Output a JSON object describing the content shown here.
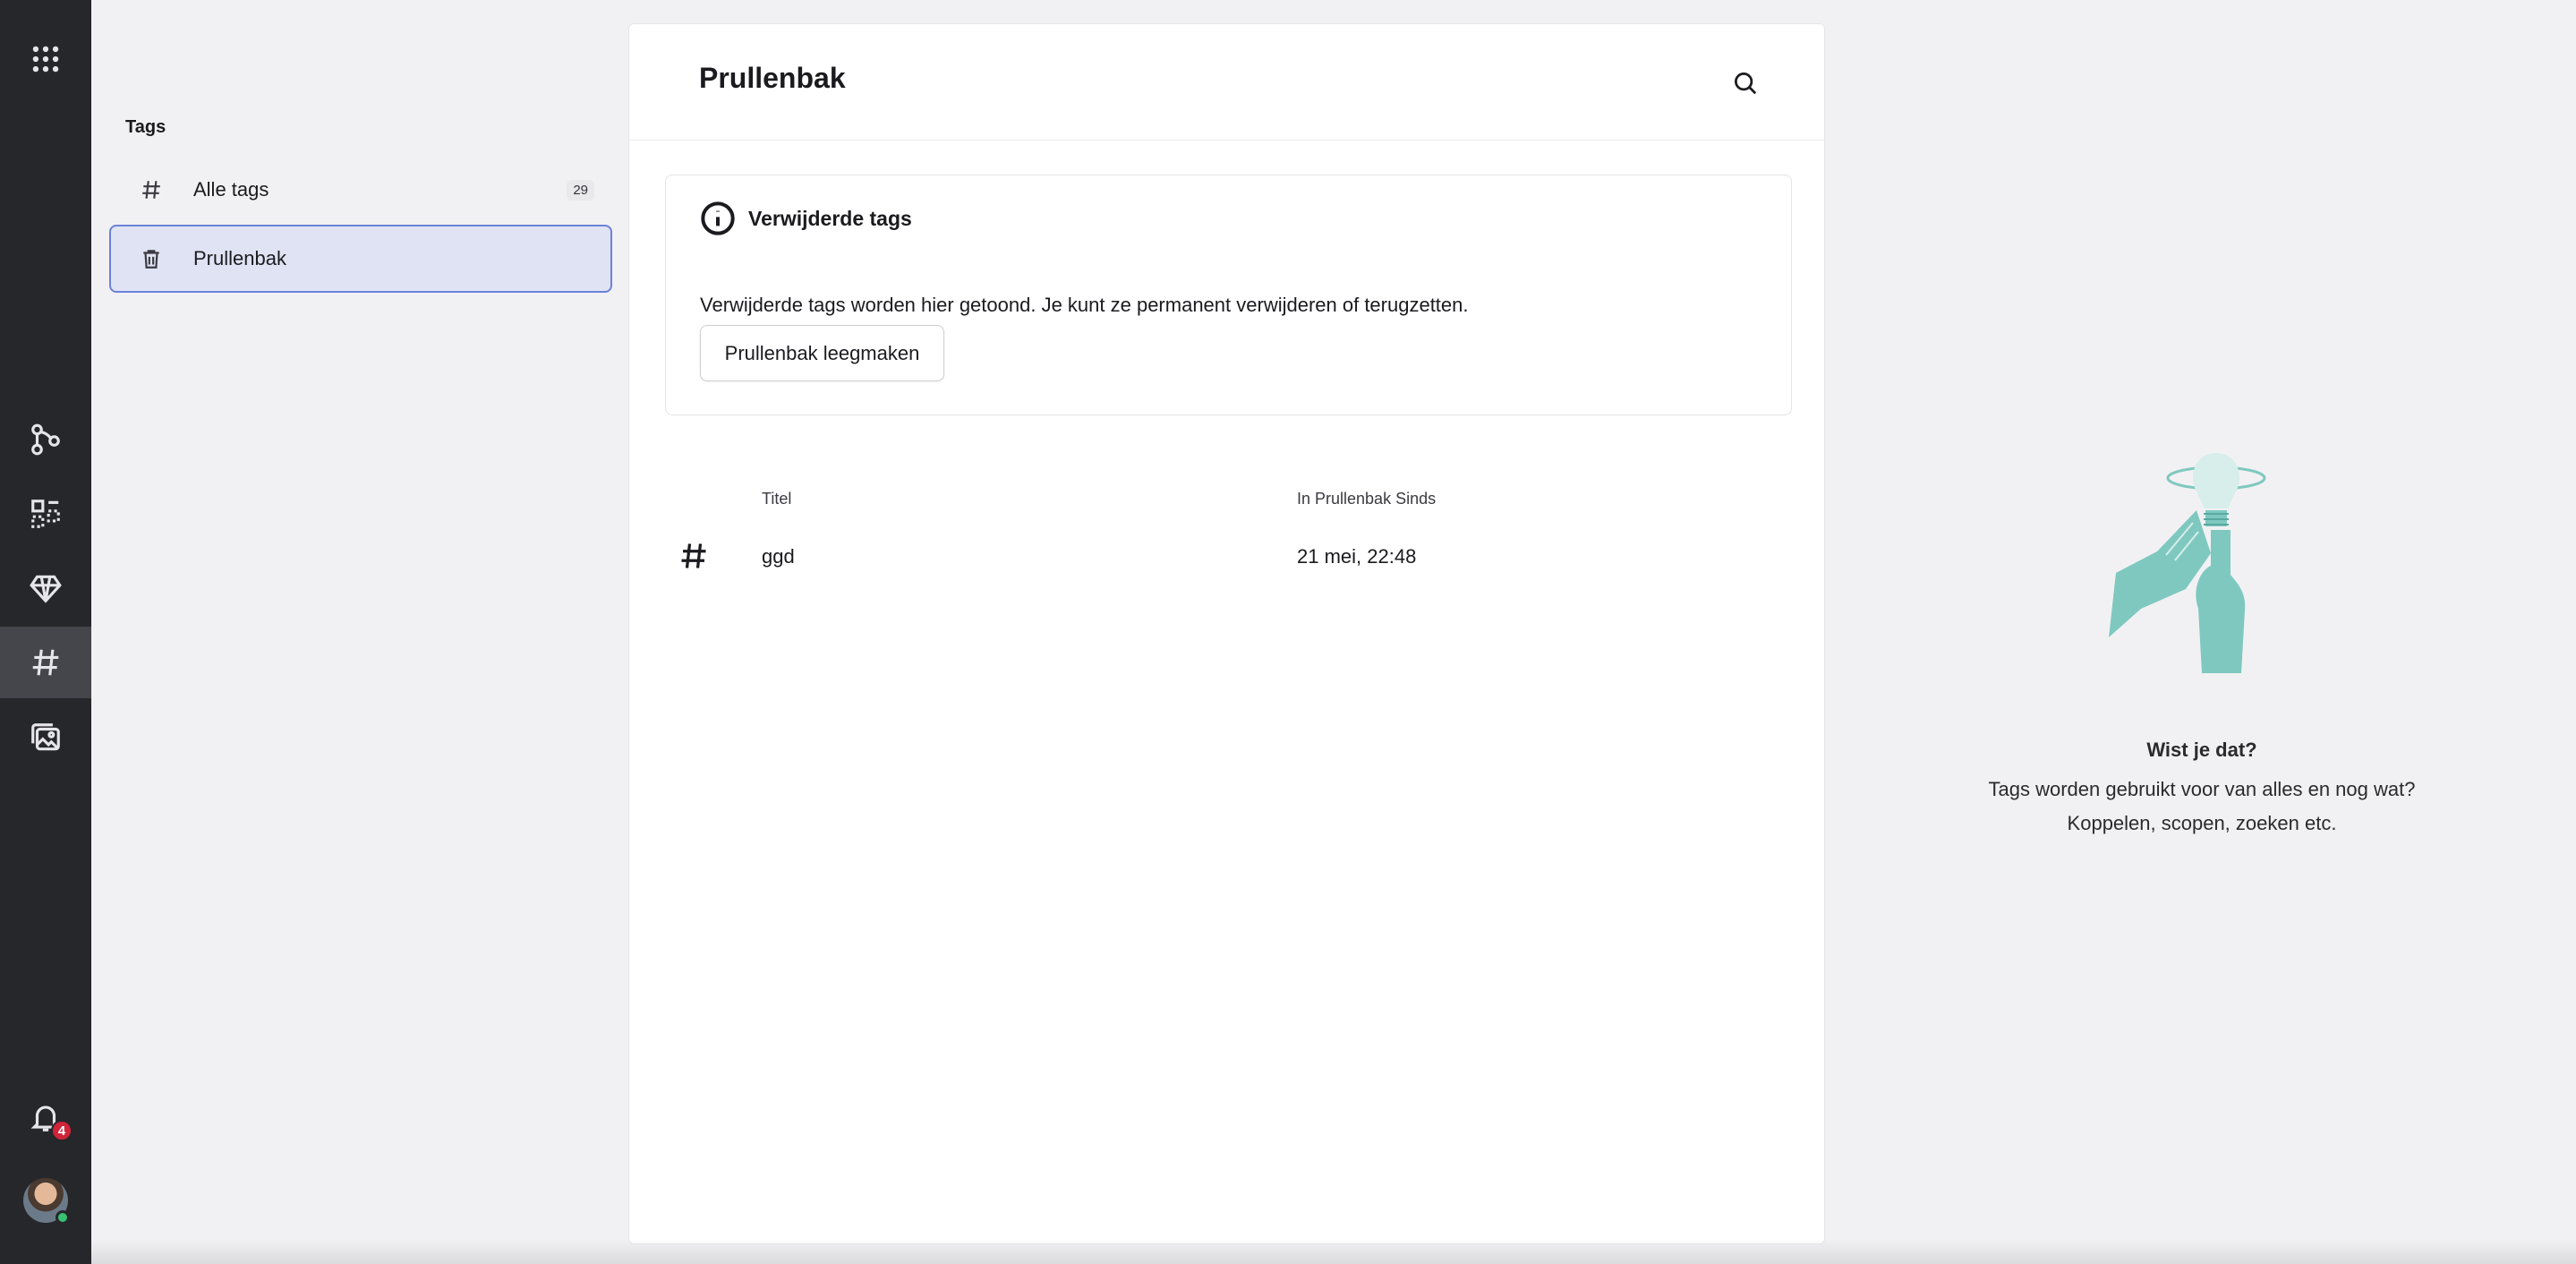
{
  "sidebar": {
    "title": "Tags",
    "items": [
      {
        "label": "Alle tags",
        "count": "29",
        "icon": "hash-icon"
      },
      {
        "label": "Prullenbak",
        "icon": "trash-icon"
      }
    ]
  },
  "main": {
    "title": "Prullenbak",
    "info": {
      "title": "Verwijderde tags",
      "text": "Verwijderde tags worden hier getoond. Je kunt ze permanent verwijderen of terugzetten.",
      "button": "Prullenbak leegmaken"
    },
    "table": {
      "headers": [
        "Titel",
        "In Prullenbak Sinds"
      ],
      "rows": [
        {
          "title": "ggd",
          "since": "21 mei, 22:48"
        }
      ]
    }
  },
  "tip": {
    "title": "Wist je dat?",
    "line1": "Tags worden gebruikt voor van alles en nog wat?",
    "line2": "Koppelen, scopen, zoeken etc."
  },
  "notifications": {
    "count": "4"
  },
  "colors": {
    "rail": "#26272b",
    "active_item_bg": "#dfe3f4",
    "active_item_border": "#6c82d8",
    "badge": "#d0243a",
    "illustration": "#7fc8c0"
  }
}
